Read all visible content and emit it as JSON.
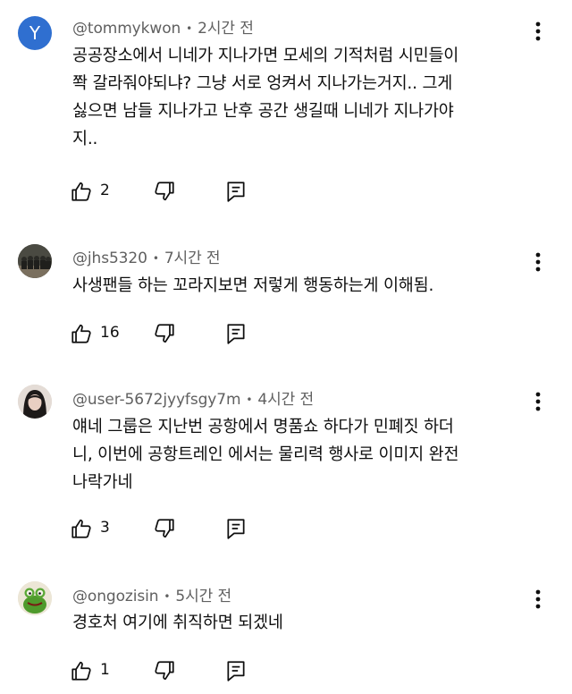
{
  "comments": [
    {
      "author": "@tommykwon",
      "time": "2시간 전",
      "avatar_letter": "Y",
      "avatar_color": "#2f6fd0",
      "lines": [
        "공공장소에서 니네가 지나가면 모세의 기적처럼 시민들이",
        "쫙 갈라줘야되냐? 그냥 서로 엉켜서 지나가는거지.. 그게",
        "싫으면 남들 지나가고 난후 공간 생길때 니네가 지나가야",
        "지.."
      ],
      "likes": "2"
    },
    {
      "author": "@jhs5320",
      "time": "7시간 전",
      "avatar_icon": "group-photo-avatar",
      "lines": [
        "사생팬들 하는 꼬라지보면 저렇게 행동하는게 이해됨."
      ],
      "likes": "16"
    },
    {
      "author": "@user-5672jyyfsgy7m",
      "time": "4시간 전",
      "avatar_icon": "person-photo-avatar",
      "lines": [
        "얘네 그룹은 지난번 공항에서 명품쇼 하다가 민폐짓 하더",
        "니, 이번에 공항트레인 에서는 물리력 행사로 이미지 완전",
        "나락가네"
      ],
      "likes": "3"
    },
    {
      "author": "@ongozisin",
      "time": "5시간 전",
      "avatar_icon": "kermit-frog-avatar",
      "lines": [
        "경호처 여기에 취직하면 되겠네"
      ],
      "likes": "1"
    }
  ],
  "icons": {
    "like": "thumbs-up-icon",
    "dislike": "thumbs-down-icon",
    "reply": "reply-icon",
    "menu": "more-vert-icon"
  },
  "colors": {
    "text": "#0f0f0f",
    "meta": "#606060",
    "avatar_blue": "#2f6fd0"
  }
}
